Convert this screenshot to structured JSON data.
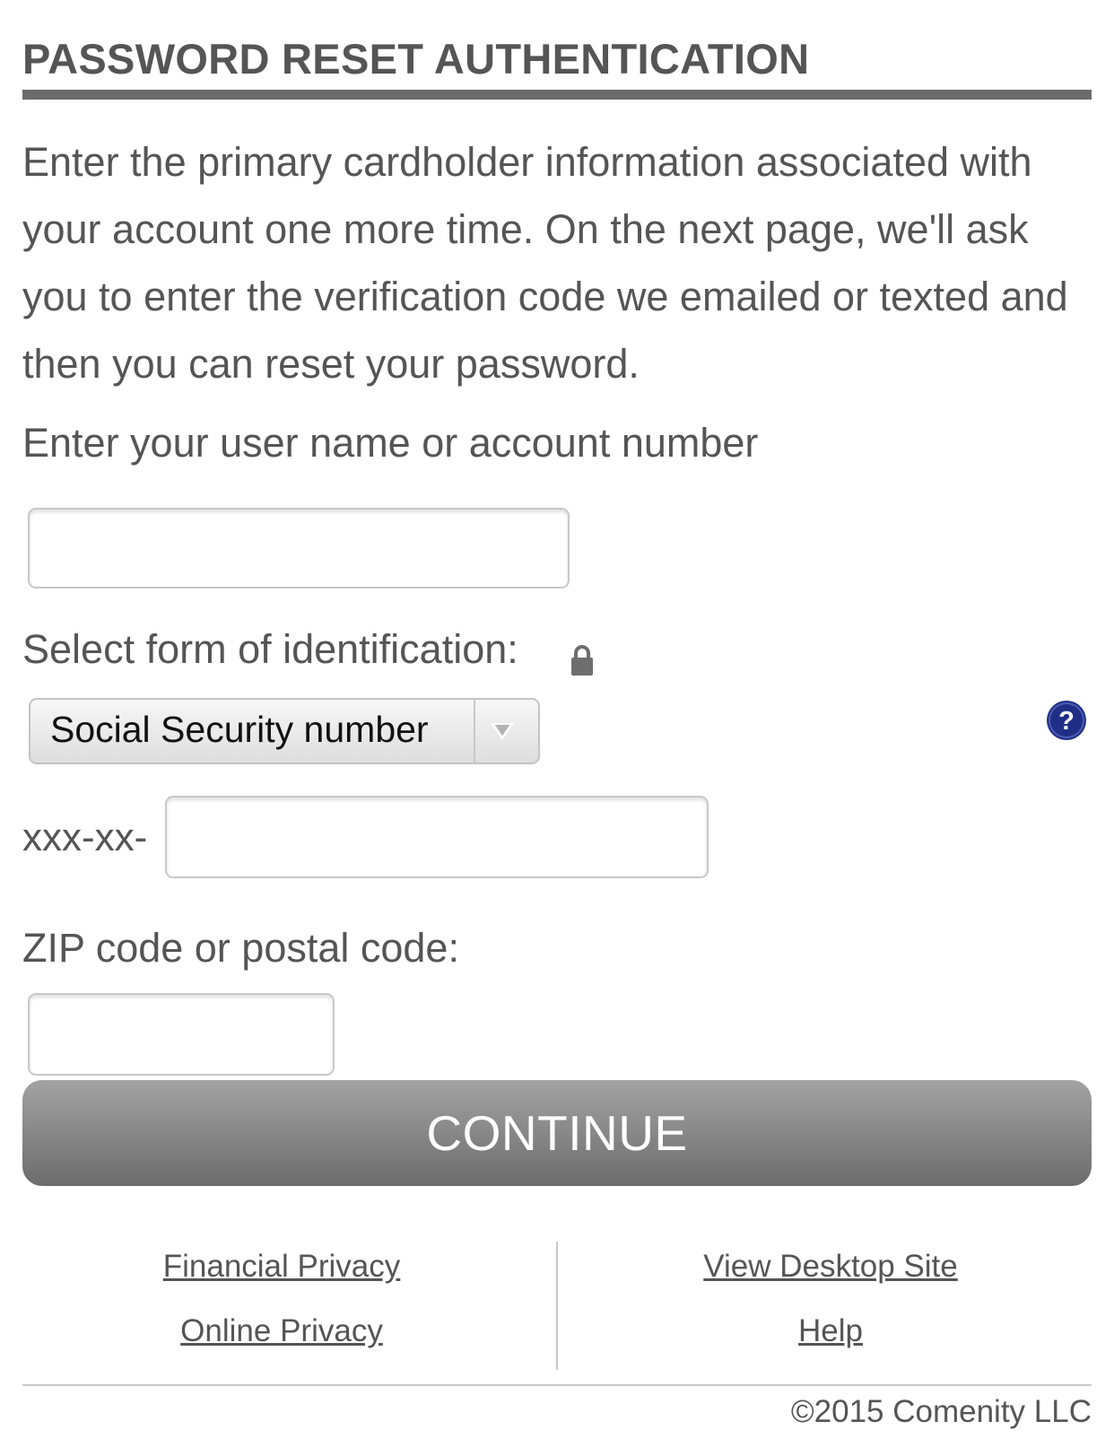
{
  "header": {
    "title": "PASSWORD RESET AUTHENTICATION"
  },
  "intro": {
    "text": "Enter the primary cardholder information associated with your account one more time. On the next page, we'll ask you to enter the verification code we emailed or texted and then you can reset your password."
  },
  "form": {
    "username": {
      "label": "Enter your user name or account number",
      "value": "",
      "placeholder": ""
    },
    "identification": {
      "label": "Select form of identification:",
      "selected": "Social Security number",
      "lock_icon": "lock-icon",
      "help_icon": "question-circle-icon"
    },
    "ssn": {
      "prefix": "xxx-xx-",
      "value": "",
      "placeholder": ""
    },
    "zip": {
      "label": "ZIP code or postal code:",
      "value": "",
      "placeholder": ""
    },
    "continue_label": "CONTINUE"
  },
  "footer": {
    "links_left": [
      "Financial Privacy",
      "Online Privacy"
    ],
    "links_right": [
      "View Desktop Site",
      "Help"
    ],
    "copyright": "©2015 Comenity LLC"
  },
  "colors": {
    "text": "#555555",
    "title_rule": "#6b6b6b",
    "button_top": "#a3a3a3",
    "button_bottom": "#6c6c6c",
    "help_icon": "#1f2f86"
  }
}
